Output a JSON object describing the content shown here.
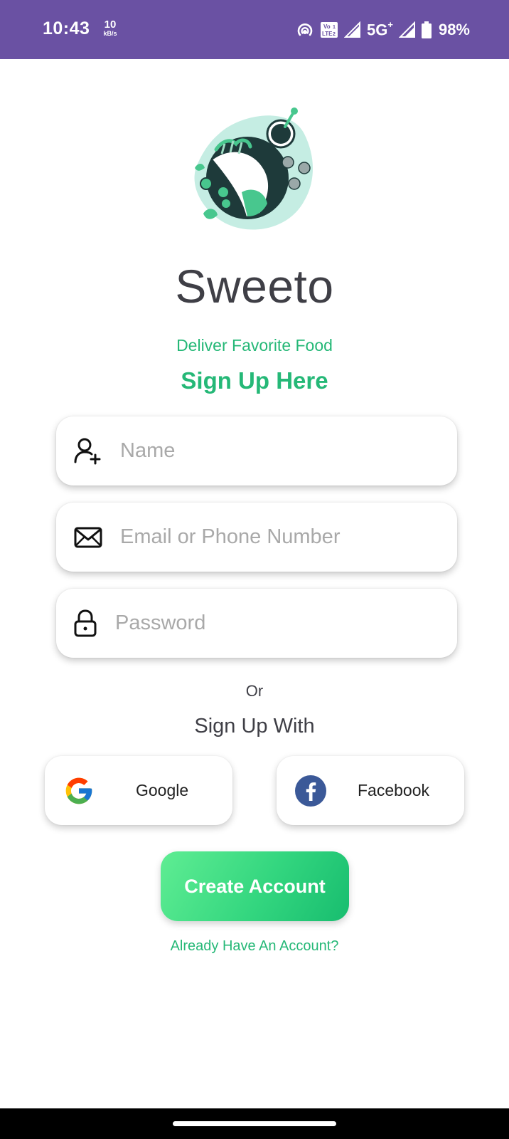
{
  "status_bar": {
    "time": "10:43",
    "net_speed_value": "10",
    "net_speed_unit": "kB/s",
    "volte_label": "Vo LTE",
    "network": "5G",
    "network_plus": "+",
    "battery": "98%"
  },
  "app": {
    "title": "Sweeto",
    "tagline": "Deliver Favorite Food",
    "heading": "Sign Up Here"
  },
  "form": {
    "name_placeholder": "Name",
    "email_placeholder": "Email or Phone Number",
    "password_placeholder": "Password",
    "name_value": "",
    "email_value": "",
    "password_value": ""
  },
  "social": {
    "or_label": "Or",
    "signup_with_label": "Sign Up With",
    "google_label": "Google",
    "facebook_label": "Facebook"
  },
  "actions": {
    "create_account_label": "Create Account",
    "login_link_label": "Already Have An Account?"
  },
  "colors": {
    "status_bar": "#6a51a3",
    "accent_green": "#25b877",
    "button_gradient_start": "#5fed93",
    "button_gradient_end": "#18bd6f",
    "facebook_blue": "#3b5998",
    "title_text": "#3f3f46"
  },
  "icons": {
    "name_field": "user-plus-icon",
    "email_field": "envelope-icon",
    "password_field": "lock-icon",
    "google": "google-logo-icon",
    "facebook": "facebook-logo-icon"
  }
}
